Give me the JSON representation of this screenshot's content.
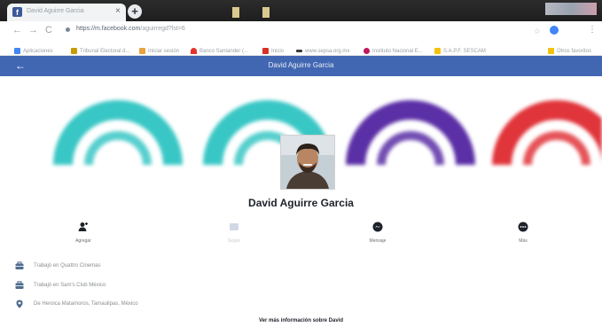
{
  "browser": {
    "tab": {
      "title": "David Aguirre Garcia",
      "favicon": "f",
      "close": "×"
    },
    "new_tab": "+",
    "nav": {
      "back": "←",
      "forward": "→",
      "reload": "C"
    },
    "url": {
      "host": "https://m.facebook.com",
      "path": "/aguirregd?lst=6"
    },
    "bookmarks": [
      {
        "label": "Aplicaciones",
        "color": "#4285f4"
      },
      {
        "label": "Tribunal Electoral d...",
        "color": "#c69c00"
      },
      {
        "label": "Iniciar sesión",
        "color": "#e8a33d"
      },
      {
        "label": "Banco Santander (...",
        "color": "#e5322d"
      },
      {
        "label": "Inicio",
        "color": "#d93025"
      },
      {
        "label": "www.sepsa.org.mx",
        "color": "#3c3c3c"
      },
      {
        "label": "Instituto Nacional E...",
        "color": "#c2185b"
      },
      {
        "label": "S.A.P.F. SESCAM",
        "color": "#f4c20d"
      },
      {
        "label": "Otros favoritos",
        "color": "#f4c20d"
      }
    ]
  },
  "header": {
    "title": "David Aguirre Garcia",
    "back_icon": "←"
  },
  "profile": {
    "name": "David Aguirre Garcia"
  },
  "actions": [
    {
      "label": "Agregar",
      "icon": "add-friend-icon"
    },
    {
      "label": "Seguir",
      "icon": "follow-icon"
    },
    {
      "label": "Mensaje",
      "icon": "messenger-icon"
    },
    {
      "label": "Más",
      "icon": "more-icon"
    }
  ],
  "info": [
    {
      "text": "Trabajó en Quattro Cinemas",
      "icon": "briefcase-icon"
    },
    {
      "text": "Trabajó en Sam's Club México",
      "icon": "briefcase-icon"
    },
    {
      "text": "De Heroica Matamoros, Tamaulipas, México",
      "icon": "location-pin-icon"
    }
  ],
  "more_link": "Ver más información sobre David",
  "colors": {
    "facebook_blue": "#4267b2",
    "cover_arcs": [
      "#39c7c5",
      "#39c7c5",
      "#5b2fa6",
      "#e0353b"
    ]
  }
}
